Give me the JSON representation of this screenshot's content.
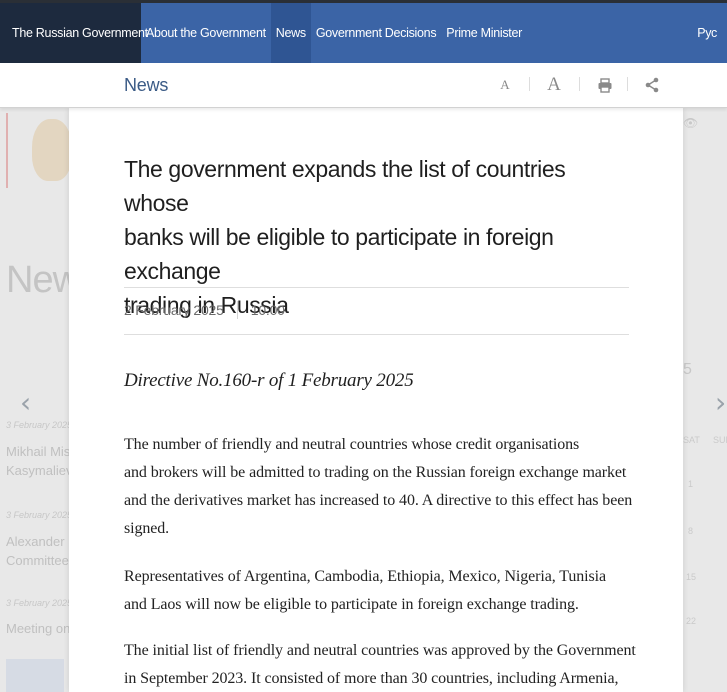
{
  "nav": {
    "brand": "The Russian Government",
    "items": [
      "About the Government",
      "News",
      "Government Decisions",
      "Prime Minister"
    ],
    "lang": "Рус"
  },
  "panel": {
    "section_title": "News",
    "font_small": "A",
    "font_large": "A"
  },
  "article": {
    "headline": [
      "The government expands the list of countries whose",
      "banks will be eligible to participate in foreign exchange",
      "trading in Russia"
    ],
    "date": "2 February 2025",
    "time": "10:00",
    "directive": "Directive No.160-r of 1 February 2025",
    "paragraphs": [
      [
        "The number of friendly and neutral countries whose credit organisations",
        "and brokers will be admitted to trading on the Russian foreign exchange market",
        "and the derivatives market has increased to 40. A directive to this effect has been",
        "signed."
      ],
      [
        "Representatives of Argentina, Cambodia, Ethiopia, Mexico, Nigeria, Tunisia",
        "and Laos will now be eligible to participate in foreign exchange trading."
      ],
      [
        "The initial list of friendly and neutral countries was approved by the Government",
        "in September 2023. It consisted of more than 30 countries, including Armenia,"
      ]
    ]
  },
  "background": {
    "heading": "New",
    "calendar_number": "5",
    "items": [
      {
        "date": "3 February 2025",
        "lines": [
          "Mikhail Mis",
          "Kasymaliev"
        ]
      },
      {
        "date": "3 February 2025",
        "lines": [
          "Alexander N",
          "Committee"
        ]
      },
      {
        "date": "3 February 2025",
        "lines": [
          "Meeting on"
        ]
      }
    ],
    "calendar_days": [
      {
        "head": "SAT",
        "value": "1",
        "alt": "SUN"
      },
      {
        "head": "",
        "value": "8",
        "alt": ""
      },
      {
        "head": "",
        "value": "15",
        "alt": ""
      },
      {
        "head": "",
        "value": "22",
        "alt": ""
      }
    ]
  },
  "colors": {
    "nav_bg": "#3b64a6",
    "brand_bg": "#1d2a3e",
    "section_title": "#3b5b86"
  }
}
